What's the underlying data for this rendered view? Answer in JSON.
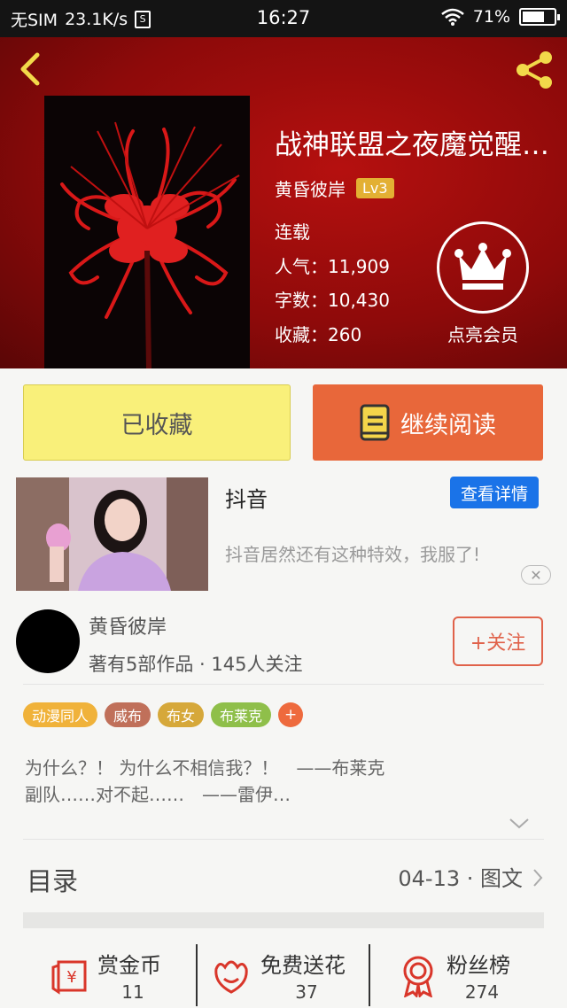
{
  "status_bar": {
    "carrier": "无SIM",
    "speed": "23.1K/s",
    "sim_icon": "S",
    "time": "16:27",
    "battery": "71%",
    "battery_level": 0.71
  },
  "book": {
    "title": "战神联盟之夜魔觉醒…",
    "author": "黄昏彼岸",
    "level": "Lv3",
    "status": "连载",
    "popularity_label": "人气：",
    "popularity": "11,909",
    "words_label": "字数：",
    "words": "10,430",
    "favorites_label": "收藏：",
    "favorites": "260"
  },
  "vip": {
    "label": "点亮会员"
  },
  "actions": {
    "collected_label": "已收藏",
    "read_label": "继续阅读"
  },
  "ad": {
    "title": "抖音",
    "detail_button": "查看详情",
    "description": "抖音居然还有这种特效，我服了!",
    "close": "✕"
  },
  "author_section": {
    "name": "黄昏彼岸",
    "meta": "著有5部作品 · 145人关注",
    "follow_label": "+关注"
  },
  "tags": [
    {
      "label": "动漫同人",
      "color": "#f0b23a"
    },
    {
      "label": "威布",
      "color": "#c0705a"
    },
    {
      "label": "布女",
      "color": "#d6a83a"
    },
    {
      "label": "布莱克",
      "color": "#8fbf4a"
    }
  ],
  "tag_add": "+",
  "synopsis": {
    "line1": "为什么？！ 为什么不相信我？！　——布莱克",
    "line2": "副队……对不起……　——雷伊…"
  },
  "toc": {
    "title": "目录",
    "info": "04-13 · 图文"
  },
  "bottom_bar": [
    {
      "label": "赏金币",
      "count": "11",
      "icon": "red-envelope-icon"
    },
    {
      "label": "免费送花",
      "count": "37",
      "icon": "flower-icon"
    },
    {
      "label": "粉丝榜",
      "count": "274",
      "icon": "medal-icon"
    }
  ],
  "colors": {
    "accent": "#e8673a",
    "hero_red": "#8e0a0a",
    "collected_yellow": "#f9f07a",
    "blue": "#1a73e8",
    "icon_red": "#d9362a"
  }
}
